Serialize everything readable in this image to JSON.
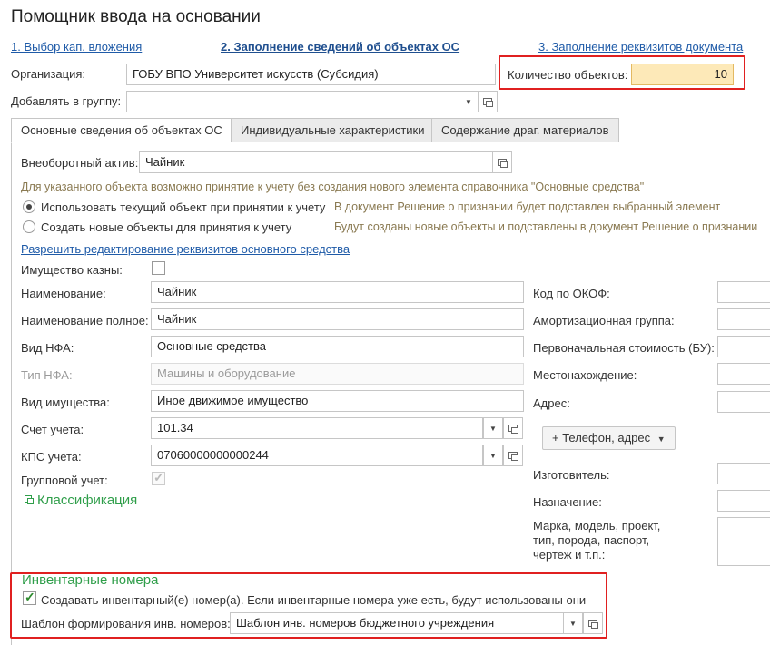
{
  "window": {
    "title": "Помощник ввода на основании"
  },
  "steps": [
    {
      "label": "1. Выбор кап. вложения"
    },
    {
      "label": "2. Заполнение сведений об объектах ОС"
    },
    {
      "label": "3. Заполнение реквизитов документа"
    }
  ],
  "org": {
    "label": "Организация:",
    "value": "ГОБУ ВПО Университет искусств (Субсидия)"
  },
  "quantity": {
    "label": "Количество объектов:",
    "value": "10"
  },
  "group": {
    "label": "Добавлять в группу:",
    "value": ""
  },
  "tabs": [
    {
      "label": "Основные сведения об объектах ОС",
      "active": true
    },
    {
      "label": "Индивидуальные характеристики",
      "active": false
    },
    {
      "label": "Содержание драг. материалов",
      "active": false
    }
  ],
  "asset": {
    "label": "Внеоборотный актив:",
    "value": "Чайник"
  },
  "info_text": "Для указанного объекта возможно принятие к учету без создания нового элемента справочника \"Основные средства\"",
  "options": [
    {
      "label": "Использовать текущий объект при принятии к учету",
      "hint": "В документ Решение о признании будет подставлен выбранный элемент",
      "selected": true
    },
    {
      "label": "Создать новые объекты для принятия к учету",
      "hint": "Будут созданы новые объекты и подставлены в документ Решение о признании",
      "selected": false
    }
  ],
  "allow_edit_link": "Разрешить редактирование реквизитов основного средства",
  "left_fields": {
    "treasury": {
      "label": "Имущество казны:",
      "checked": false
    },
    "name": {
      "label": "Наименование:",
      "value": "Чайник"
    },
    "full_name": {
      "label": "Наименование полное:",
      "value": "Чайник"
    },
    "nfa_kind": {
      "label": "Вид НФА:",
      "value": "Основные средства"
    },
    "nfa_type": {
      "label": "Тип НФА:",
      "value": "Машины и оборудование"
    },
    "property_kind": {
      "label": "Вид имущества:",
      "value": "Иное движимое имущество"
    },
    "account": {
      "label": "Счет учета:",
      "value": "101.34"
    },
    "kps": {
      "label": "КПС учета:",
      "value": "07060000000000244"
    },
    "group_accounting": {
      "label": "Групповой учет:",
      "checked": true
    }
  },
  "classification": {
    "label": "Классификация"
  },
  "right_fields": {
    "okof": {
      "label": "Код по ОКОФ:"
    },
    "amort_group": {
      "label": "Амортизационная группа:"
    },
    "initial_cost": {
      "label": "Первоначальная стоимость (БУ):"
    },
    "location": {
      "label": "Местонахождение:"
    },
    "address": {
      "label": "Адрес:"
    },
    "phone_button": {
      "label": "+ Телефон, адрес"
    },
    "manufacturer": {
      "label": "Изготовитель:"
    },
    "purpose": {
      "label": "Назначение:"
    },
    "brand_model": {
      "label": "Марка, модель, проект, тип, порода, паспорт, чертеж и т.п.:"
    }
  },
  "inventory": {
    "header": "Инвентарные номера",
    "create_checkbox": {
      "label": "Создавать инвентарный(е) номер(а). Если инвентарные номера уже есть, будут использованы они",
      "checked": true
    },
    "template": {
      "label": "Шаблон формирования инв. номеров:",
      "value": "Шаблон инв. номеров бюджетного учреждения"
    }
  },
  "colors": {
    "accent_link": "#1f5ba8",
    "highlight_red": "#e02020",
    "quantity_bg": "#fde9b8",
    "section_green": "#2f9e4a",
    "hint_text": "#8a7a52"
  }
}
